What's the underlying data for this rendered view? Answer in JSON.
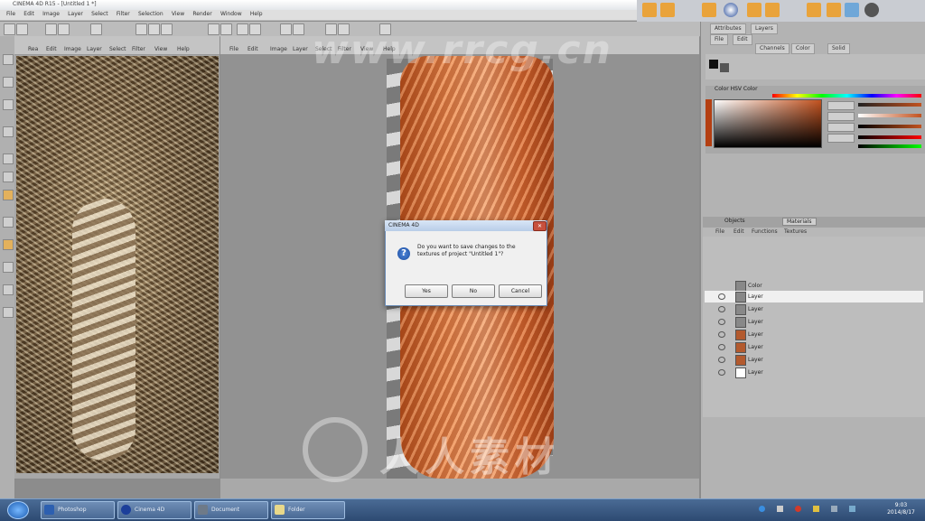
{
  "window": {
    "title": "CINEMA 4D R15 - [Untitled 1 *]"
  },
  "menu": [
    "File",
    "Edit",
    "Image",
    "Layer",
    "Select",
    "Filter",
    "Selection",
    "View",
    "Render",
    "Window",
    "Help"
  ],
  "left_panel": {
    "tabs": [
      "Rea",
      "Edit",
      "Image",
      "Layer",
      "Select",
      "Filter",
      "View",
      "Help"
    ]
  },
  "canvas_panel": {
    "tabs": [
      "File",
      "Edit",
      "Image",
      "Layer",
      "Select",
      "Filter",
      "View",
      "Help"
    ]
  },
  "right_panel": {
    "top_tabs": [
      "Attributes",
      "Layers"
    ],
    "sub_tabs": [
      "File",
      "Edit"
    ],
    "selects": [
      "Channels",
      "Color",
      "Solid"
    ],
    "color_title": "Color HSV Color",
    "color_swatch": "#b43f12"
  },
  "layers_panel": {
    "tabs": [
      "Objects",
      "Materials"
    ],
    "menu": [
      "File",
      "Edit",
      "Functions",
      "Textures"
    ],
    "rows": [
      {
        "name": "Color"
      },
      {
        "name": "Layer"
      },
      {
        "name": "Layer"
      },
      {
        "name": "Layer"
      },
      {
        "name": "Layer"
      },
      {
        "name": "Layer"
      },
      {
        "name": "Layer"
      },
      {
        "name": "Layer"
      },
      {
        "name": "Layer"
      }
    ]
  },
  "dialog": {
    "title": "CINEMA 4D",
    "message": "Do you want to save changes to the textures of project \"Untitled 1\"?",
    "buttons": [
      "Yes",
      "No",
      "Cancel"
    ]
  },
  "taskbar": {
    "tasks": [
      {
        "label": "Photoshop",
        "color": "#2c5fb0"
      },
      {
        "label": "Cinema 4D",
        "color": "#1c3f9a"
      },
      {
        "label": "Document",
        "color": "#6e7a88"
      },
      {
        "label": "Folder",
        "color": "#e8d88a"
      }
    ],
    "clock_time": "9:03",
    "clock_date": "2014/8/17"
  },
  "watermarks": {
    "top": "www.rrcg.cn",
    "bottom": "人人素材"
  },
  "accent_colors": {
    "brand_blue": "#1c3f9a",
    "hair_orange": "#e98a4f"
  }
}
